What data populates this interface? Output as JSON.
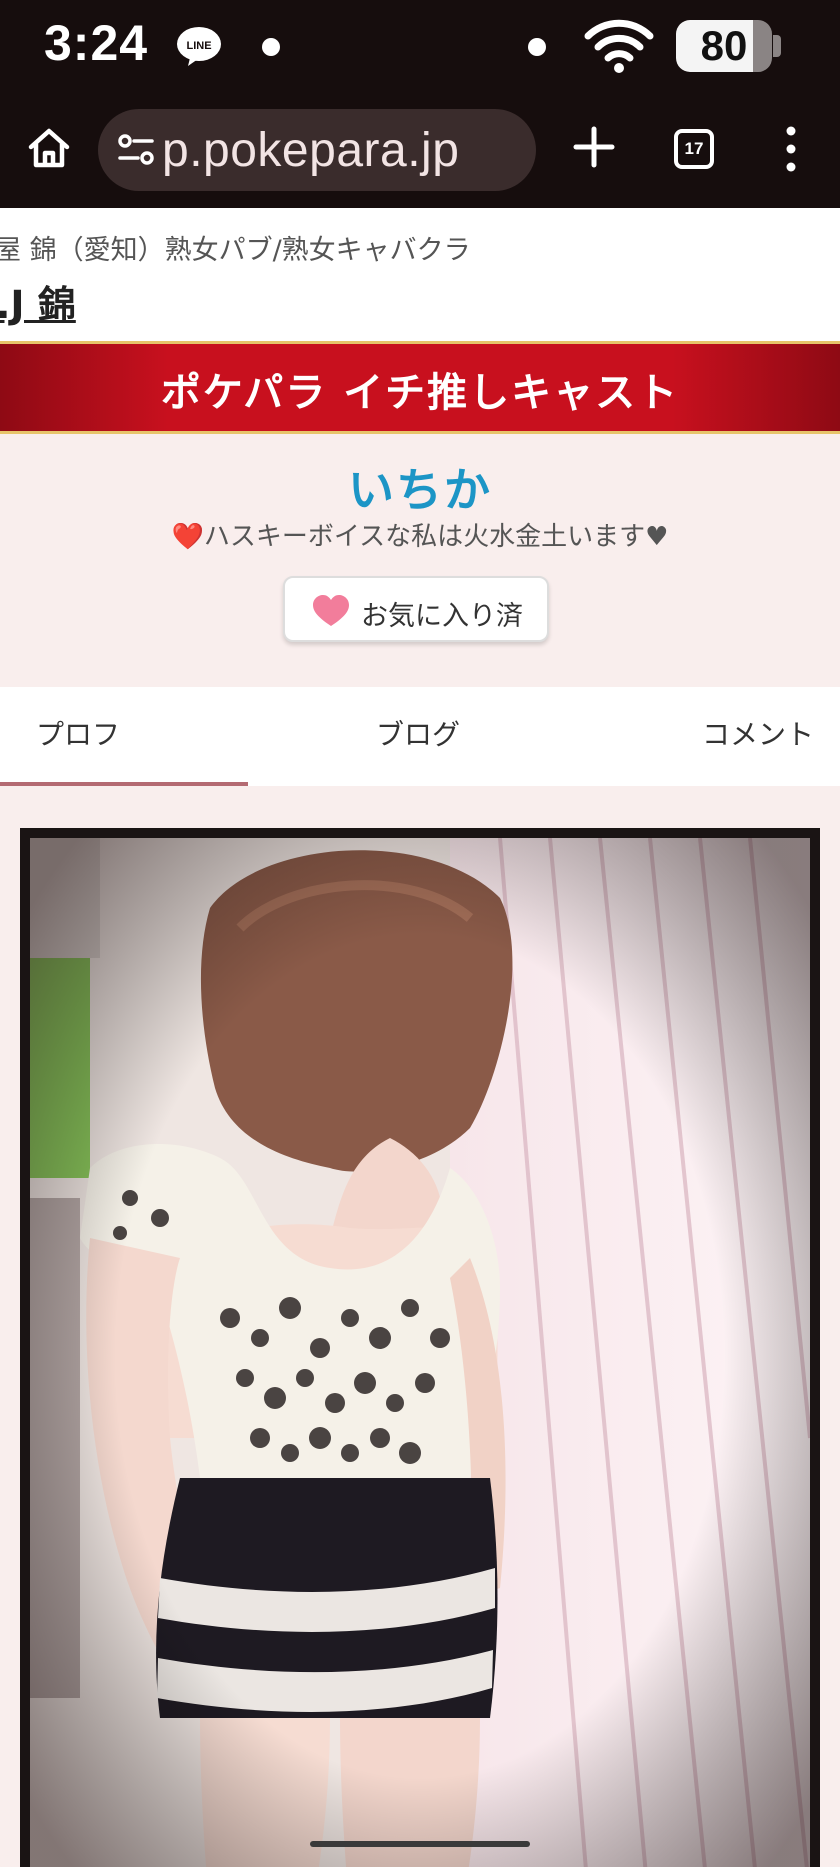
{
  "status_bar": {
    "time": "3:24",
    "app_notification_icon": "line-app-icon",
    "battery_level": 80,
    "battery_text": "80",
    "wifi_icon": "wifi-icon"
  },
  "browser": {
    "url_text": "p.pokepara.jp",
    "tab_count": "17",
    "icons": [
      "home-icon",
      "site-settings-icon",
      "plus-icon",
      "tab-switcher-icon",
      "more-vert-icon"
    ]
  },
  "page_header": {
    "breadcrumb": "屋 錦（愛知）熟女パブ/熟女キャバクラ",
    "shop_name": ".J 錦"
  },
  "banner": {
    "title": "ポケパラ イチ推しキャスト"
  },
  "cast": {
    "name": "いちか",
    "catchphrase": "❤️ハスキーボイスな私は火水金土います♥",
    "favorite_button_label": "お気に入り済",
    "favorite_icon": "heart-icon",
    "favorited": true
  },
  "tabs": {
    "items": [
      {
        "label": "プロフ",
        "active": true
      },
      {
        "label": "ブログ",
        "active": false
      },
      {
        "label": "コメント",
        "active": false
      }
    ]
  },
  "photo": {
    "subject": "cast-profile-photo"
  },
  "colors": {
    "status_bar_bg": "#160d0d",
    "banner_red": "#c8101e",
    "banner_gold": "#e7c46a",
    "cast_name_blue": "#1c95c6",
    "page_bg": "#f9eeed",
    "tab_indicator": "#b46a72",
    "heart_pink": "#f27d9b"
  }
}
